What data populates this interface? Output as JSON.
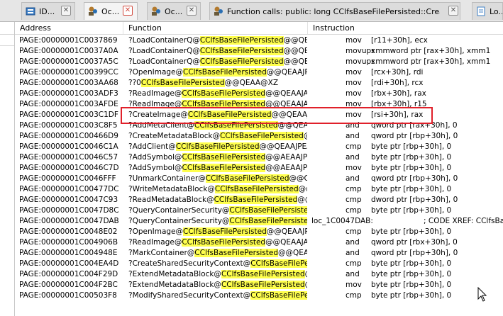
{
  "tabs": [
    {
      "label": "ID...",
      "icon": "database-icon",
      "active": false
    },
    {
      "label": "Oc...",
      "icon": "function-icon",
      "active": true
    },
    {
      "label": "Oc...",
      "icon": "function-icon",
      "active": false
    },
    {
      "label": "Function calls: public: long CClfsBaseFilePersisted::CreateIma...",
      "icon": "function-icon",
      "active": false
    },
    {
      "label": "Lo...",
      "icon": "document-icon",
      "active": false
    }
  ],
  "columns": {
    "address": "Address",
    "function": "Function",
    "instruction": "Instruction"
  },
  "highlight_term": "CClfsBaseFilePersisted",
  "rows": [
    {
      "address": "PAGE:00000001C0037869",
      "fn_pre": "?LoadContainerQ@",
      "fn_hl": "CClfsBaseFilePersisted",
      "fn_post": "@@QEA...",
      "mnemonic": "mov",
      "operands": "[r11+30h], ecx"
    },
    {
      "address": "PAGE:00000001C0037A0A",
      "fn_pre": "?LoadContainerQ@",
      "fn_hl": "CClfsBaseFilePersisted",
      "fn_post": "@@QEA...",
      "mnemonic": "movups",
      "operands": "xmmword ptr [rax+30h], xmm1"
    },
    {
      "address": "PAGE:00000001C0037A5C",
      "fn_pre": "?LoadContainerQ@",
      "fn_hl": "CClfsBaseFilePersisted",
      "fn_post": "@@QEA...",
      "mnemonic": "movups",
      "operands": "xmmword ptr [rax+30h], xmm1"
    },
    {
      "address": "PAGE:00000001C00399CC",
      "fn_pre": "?OpenImage@",
      "fn_hl": "CClfsBaseFilePersisted",
      "fn_post": "@@QEAAJP...",
      "mnemonic": "mov",
      "operands": "[rcx+30h], rdi"
    },
    {
      "address": "PAGE:00000001C003AA68",
      "fn_pre": "??0",
      "fn_hl": "CClfsBaseFilePersisted",
      "fn_post": "@@QEAA@XZ",
      "mnemonic": "mov",
      "operands": "[rdi+30h], rcx"
    },
    {
      "address": "PAGE:00000001C003ADF3",
      "fn_pre": "?ReadImage@",
      "fn_hl": "CClfsBaseFilePersisted",
      "fn_post": "@@QEAAJA...",
      "mnemonic": "mov",
      "operands": "[rbx+30h], rax"
    },
    {
      "address": "PAGE:00000001C003AFDE",
      "fn_pre": "?ReadImage@",
      "fn_hl": "CClfsBaseFilePersisted",
      "fn_post": "@@QEAAJA...",
      "mnemonic": "mov",
      "operands": "[rbx+30h], r15"
    },
    {
      "address": "PAGE:00000001C003C1DF",
      "fn_pre": "?CreateImage@",
      "fn_hl": "CClfsBaseFilePersisted",
      "fn_post": "@@QEAAJ...",
      "mnemonic": "mov",
      "operands": "[rsi+30h], rax"
    },
    {
      "address": "PAGE:00000001C003C8F5",
      "fn_pre": "?AddMetaClient@",
      "fn_hl": "CClfsBaseFilePersisted",
      "fn_post": "@@QEAAJ...",
      "mnemonic": "and",
      "operands": "qword ptr [rax+30h], 0"
    },
    {
      "address": "PAGE:00000001C00466D9",
      "fn_pre": "?CreateMetadataBlock@",
      "fn_hl": "CClfsBaseFilePersisted",
      "fn_post": "@@Q...",
      "mnemonic": "and",
      "operands": "qword ptr [rbp+30h], 0"
    },
    {
      "address": "PAGE:00000001C0046C1A",
      "fn_pre": "?AddClient@",
      "fn_hl": "CClfsBaseFilePersisted",
      "fn_post": "@@QEAAJPEA...",
      "mnemonic": "cmp",
      "operands": "byte ptr [rbp+30h], 0"
    },
    {
      "address": "PAGE:00000001C0046C57",
      "fn_pre": "?AddSymbol@",
      "fn_hl": "CClfsBaseFilePersisted",
      "fn_post": "@@AEAAJPE...",
      "mnemonic": "and",
      "operands": "byte ptr [rbp+30h], 0"
    },
    {
      "address": "PAGE:00000001C0046C7D",
      "fn_pre": "?AddSymbol@",
      "fn_hl": "CClfsBaseFilePersisted",
      "fn_post": "@@AEAAJPE...",
      "mnemonic": "mov",
      "operands": "byte ptr [rbp+30h], 0"
    },
    {
      "address": "PAGE:00000001C0046FFF",
      "fn_pre": "?UnmarkContainer@",
      "fn_hl": "CClfsBaseFilePersisted",
      "fn_post": "@@Q...",
      "mnemonic": "and",
      "operands": "qword ptr [rbp+30h], 0"
    },
    {
      "address": "PAGE:00000001C00477DC",
      "fn_pre": "?WriteMetadataBlock@",
      "fn_hl": "CClfsBaseFilePersisted",
      "fn_post": "@@Q...",
      "mnemonic": "cmp",
      "operands": "byte ptr [rbp+30h], 0"
    },
    {
      "address": "PAGE:00000001C0047C93",
      "fn_pre": "?ReadMetadataBlock@",
      "fn_hl": "CClfsBaseFilePersisted",
      "fn_post": "@@Q...",
      "mnemonic": "cmp",
      "operands": "dword ptr [rbp+30h], 0"
    },
    {
      "address": "PAGE:00000001C0047D8C",
      "fn_pre": "?QueryContainerSecurity@",
      "fn_hl": "CClfsBaseFilePersisted",
      "fn_post": "...",
      "mnemonic": "cmp",
      "operands": "byte ptr [rbp+30h], 0"
    },
    {
      "address": "PAGE:00000001C0047DAB",
      "fn_pre": "?QueryContainerSecurity@",
      "fn_hl": "CClfsBaseFilePersisted",
      "fn_post": "...",
      "label": "loc_1C0047DAB:",
      "comment": "; CODE XREF: CClfsBaseFil"
    },
    {
      "address": "PAGE:00000001C0048E02",
      "fn_pre": "?OpenImage@",
      "fn_hl": "CClfsBaseFilePersisted",
      "fn_post": "@@QEAAJP...",
      "mnemonic": "cmp",
      "operands": "byte ptr [rbp+30h], 0"
    },
    {
      "address": "PAGE:00000001C004906B",
      "fn_pre": "?ReadImage@",
      "fn_hl": "CClfsBaseFilePersisted",
      "fn_post": "@@QEAAJA...",
      "mnemonic": "and",
      "operands": "qword ptr [rbx+30h], 0"
    },
    {
      "address": "PAGE:00000001C004948E",
      "fn_pre": "?MarkContainer@",
      "fn_hl": "CClfsBaseFilePersisted",
      "fn_post": "@@QEA...",
      "mnemonic": "and",
      "operands": "qword ptr [rbp+30h], 0"
    },
    {
      "address": "PAGE:00000001C004EA4D",
      "fn_pre": "?CreateSharedSecurityContext@",
      "fn_hl": "CClfsBaseFilePer...",
      "fn_post": "",
      "mnemonic": "cmp",
      "operands": "byte ptr [rbp+30h], 0"
    },
    {
      "address": "PAGE:00000001C004F29D",
      "fn_pre": "?ExtendMetadataBlock@",
      "fn_hl": "CClfsBaseFilePersisted",
      "fn_post": "@...",
      "mnemonic": "and",
      "operands": "byte ptr [rbp+30h], 0"
    },
    {
      "address": "PAGE:00000001C004F2BC",
      "fn_pre": "?ExtendMetadataBlock@",
      "fn_hl": "CClfsBaseFilePersisted",
      "fn_post": "@...",
      "mnemonic": "mov",
      "operands": "byte ptr [rbp+30h], 0"
    },
    {
      "address": "PAGE:00000001C00503F8",
      "fn_pre": "?ModifySharedSecurityContext@",
      "fn_hl": "CClfsBaseFilePer...",
      "fn_post": "",
      "mnemonic": "cmp",
      "operands": "byte ptr [rbp+30h], 0"
    }
  ],
  "selected_row_index": 7,
  "colors": {
    "highlight": "#ffff4d",
    "selection_box": "#e0202a",
    "tab_close_active": "#d24a3e"
  }
}
